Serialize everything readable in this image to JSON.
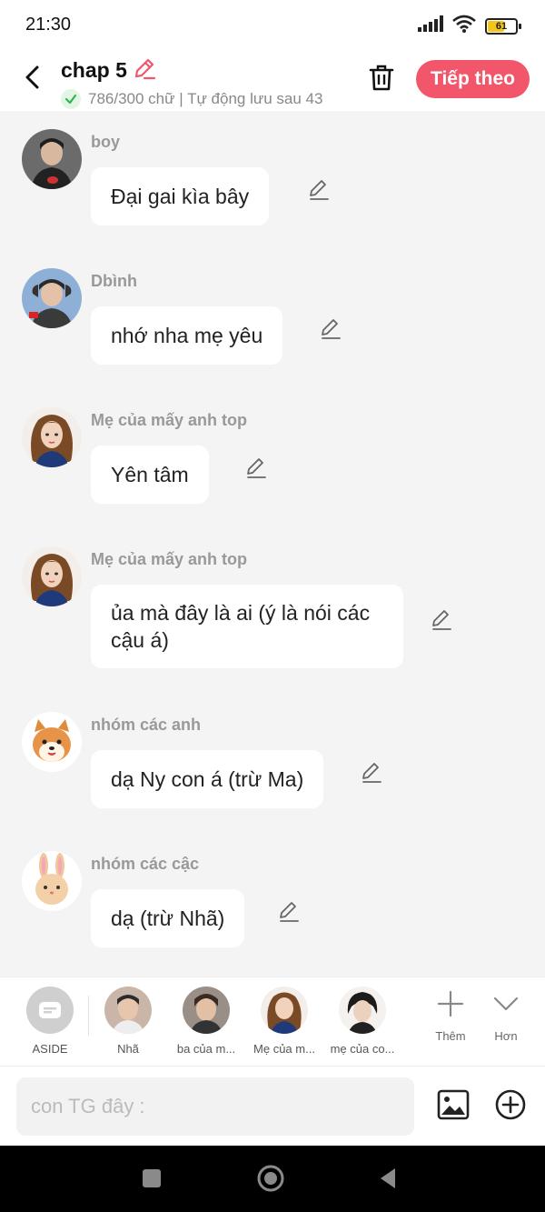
{
  "status_bar": {
    "time": "21:30",
    "battery": "61",
    "battery_level": 0.61
  },
  "header": {
    "title": "chap 5",
    "word_count": "786/300 chữ | Tự động lưu sau 43",
    "next_label": "Tiếp theo",
    "accent_color": "#f2566a"
  },
  "messages": [
    {
      "name": "boy",
      "text": "Đại gai kìa bây",
      "avatar": "boy-avatar"
    },
    {
      "name": "Dbình",
      "text": "nhớ nha mẹ yêu",
      "avatar": "dbinh-avatar"
    },
    {
      "name": "Mẹ của mấy anh top",
      "text": "Yên tâm",
      "avatar": "woman-avatar"
    },
    {
      "name": "Mẹ của mấy anh top",
      "text": "ủa mà đây là ai (ý là nói các cậu á)",
      "avatar": "woman-avatar"
    },
    {
      "name": "nhóm các anh",
      "text": "dạ Ny con á (trừ Ma)",
      "avatar": "shiba-avatar"
    },
    {
      "name": "nhóm các cậc",
      "text": "dạ (trừ Nhã)",
      "avatar": "bunny-avatar"
    }
  ],
  "characters": [
    {
      "label": "ASIDE"
    },
    {
      "label": "Nhã"
    },
    {
      "label": "ba của m..."
    },
    {
      "label": "Mẹ của m..."
    },
    {
      "label": "mẹ của co..."
    }
  ],
  "tools": {
    "more_label": "Thêm",
    "expand_label": "Hơn"
  },
  "input": {
    "placeholder": "con TG đây :"
  }
}
